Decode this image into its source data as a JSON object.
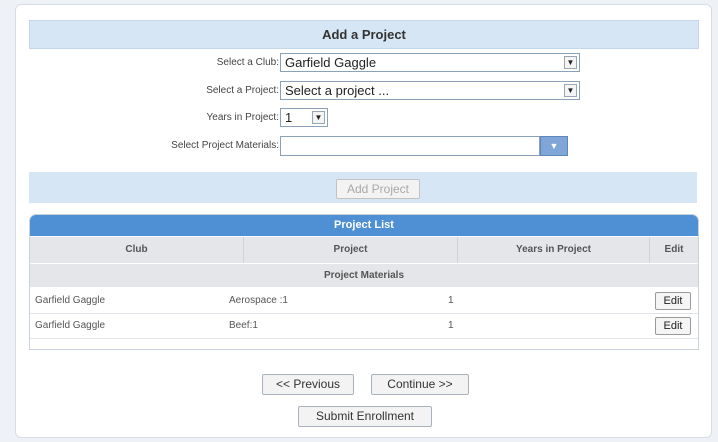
{
  "add_project": {
    "title": "Add a Project",
    "club_label": "Select a Club:",
    "club_value": "Garfield Gaggle",
    "project_label": "Select a Project:",
    "project_value": "Select a project ...",
    "years_label": "Years in Project:",
    "years_value": "1",
    "materials_label": "Select Project Materials:",
    "materials_value": "",
    "add_button": "Add Project"
  },
  "project_list": {
    "title": "Project List",
    "columns": [
      "Club",
      "Project",
      "Years in Project",
      "Edit"
    ],
    "materials_header": "Project Materials",
    "rows": [
      {
        "club": "Garfield Gaggle",
        "project": "Aerospace :1",
        "years": "1",
        "edit": "Edit"
      },
      {
        "club": "Garfield Gaggle",
        "project": "Beef:1",
        "years": "1",
        "edit": "Edit"
      }
    ]
  },
  "nav": {
    "previous": "<< Previous",
    "continue": "Continue >>",
    "submit": "Submit Enrollment"
  },
  "icons": {
    "dropdown": "chevron-down-icon"
  },
  "colors": {
    "header_bg": "#d7e6f5",
    "list_title_bg": "#4f8fd3"
  }
}
